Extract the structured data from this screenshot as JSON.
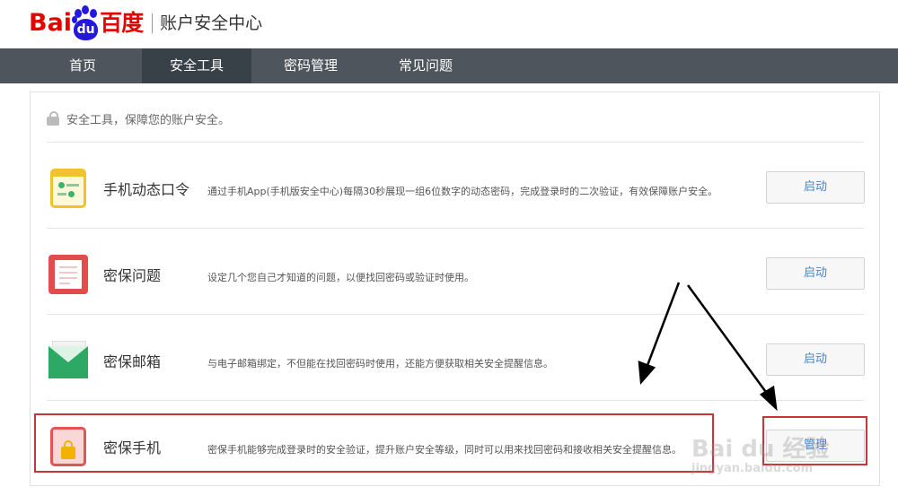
{
  "header": {
    "logo_bai": "Bai",
    "logo_du": "du",
    "logo_cn": "百度",
    "site_title": "账户安全中心"
  },
  "nav": {
    "tabs": [
      {
        "label": "首页",
        "active": false
      },
      {
        "label": "安全工具",
        "active": true
      },
      {
        "label": "密码管理",
        "active": false
      },
      {
        "label": "常见问题",
        "active": false
      }
    ]
  },
  "panel": {
    "hint": "安全工具，保障您的账户安全。",
    "tools": [
      {
        "title": "手机动态口令",
        "desc": "通过手机App(手机版安全中心)每隔30秒展现一组6位数字的动态密码，完成登录时的二次验证，有效保障账户安全。",
        "button": "启动",
        "icon": "phone-token-icon"
      },
      {
        "title": "密保问题",
        "desc": "设定几个您自己才知道的问题，以便找回密码或验证时使用。",
        "button": "启动",
        "icon": "security-question-icon"
      },
      {
        "title": "密保邮箱",
        "desc": "与电子邮箱绑定，不但能在找回密码时使用，还能方便获取相关安全提醒信息。",
        "button": "启动",
        "icon": "mail-icon"
      },
      {
        "title": "密保手机",
        "desc": "密保手机能够完成登录时的安全验证，提升账户安全等级，同时可以用来找回密码和接收相关安全提醒信息。",
        "button": "管理",
        "icon": "mobile-lock-icon"
      }
    ]
  },
  "colors": {
    "nav_bg": "#4e555d",
    "nav_active": "#384048",
    "brand_red": "#e10601",
    "brand_blue": "#2319dc",
    "button_text": "#4a84c6",
    "highlight": "#c9343a"
  },
  "watermark": {
    "line1": "Bai du 经验",
    "line2": "jingyan.baidu.com"
  }
}
